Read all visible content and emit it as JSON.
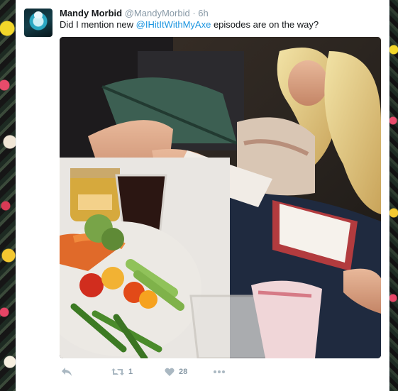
{
  "tweet": {
    "display_name": "Mandy Morbid",
    "handle": "@MandyMorbid",
    "separator": "·",
    "time": "6h",
    "text_before": "Did I mention new ",
    "mention": "@IHitItWithMyAxe",
    "text_after": " episodes are on the way?",
    "accent_color": "#1b95e0"
  },
  "actions": {
    "reply_icon": "reply-icon",
    "retweet_icon": "retweet-icon",
    "retweet_count": "1",
    "like_icon": "heart-icon",
    "like_count": "28",
    "more_icon": "more-icon"
  }
}
